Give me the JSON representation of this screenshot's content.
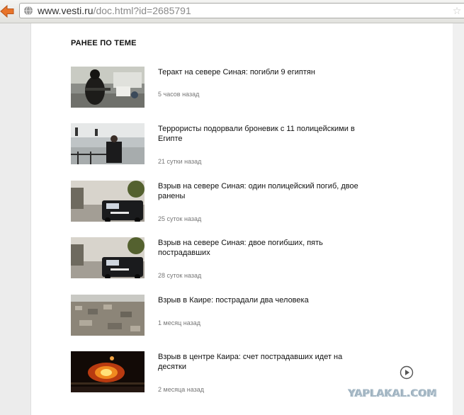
{
  "browser": {
    "url_host": "www.vesti.ru",
    "url_path": "/doc.html?id=2685791"
  },
  "section": {
    "title": "РАНЕЕ ПО ТЕМЕ"
  },
  "news": [
    {
      "headline": "Теракт на севере Синая: погибли 9 египтян",
      "time": "5 часов назад"
    },
    {
      "headline": "Террористы подорвали броневик с 11 полицейскими в Египте",
      "time": "21 сутки назад"
    },
    {
      "headline": "Взрыв на севере Синая: один полицейский погиб, двое ранены",
      "time": "25 суток назад"
    },
    {
      "headline": "Взрыв на севере Синая: двое погибших, пять пострадавших",
      "time": "28 суток назад"
    },
    {
      "headline": "Взрыв в Каире: пострадали два человека",
      "time": "1 месяц назад"
    },
    {
      "headline": "Взрыв в центре Каира: счет пострадавших идет на десятки",
      "time": "2 месяца назад"
    }
  ],
  "watermark": "YAPLAKAL.COM",
  "colors": {
    "back_arrow": "#e8742a",
    "headline_text": "#111111",
    "time_text": "#777777"
  }
}
